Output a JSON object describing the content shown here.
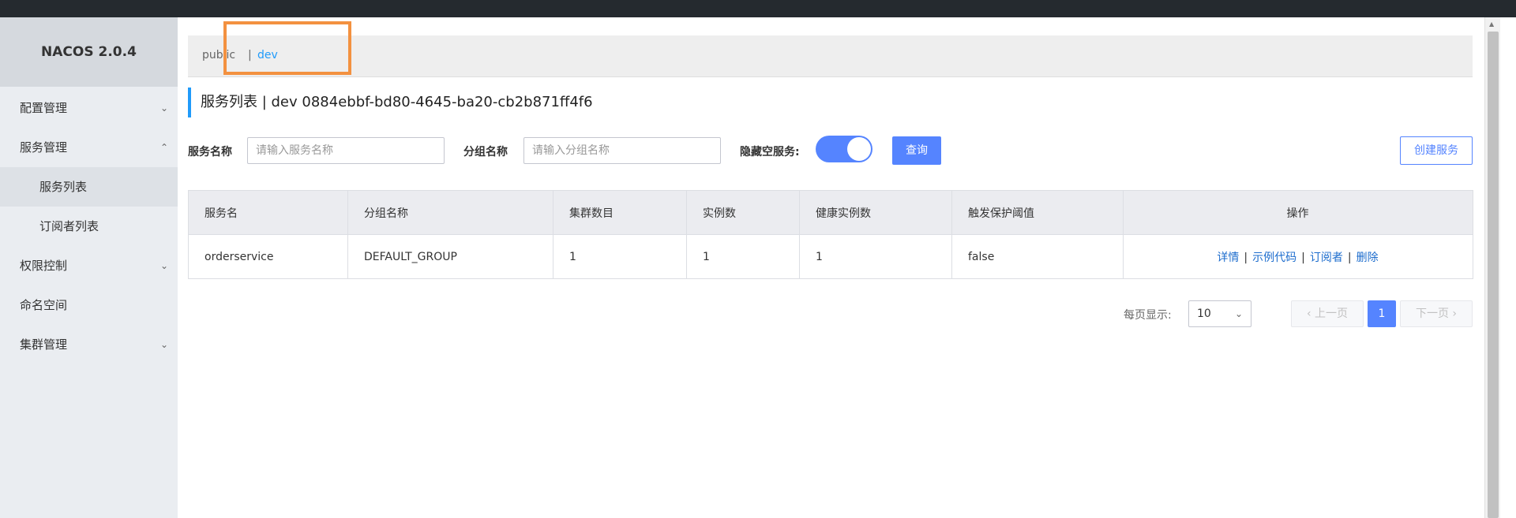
{
  "app": {
    "logo": "NACOS 2.0.4"
  },
  "sidebar": {
    "items": [
      {
        "label": "配置管理",
        "expanded": false
      },
      {
        "label": "服务管理",
        "expanded": true
      },
      {
        "label": "服务列表",
        "sub": true,
        "active": true
      },
      {
        "label": "订阅者列表",
        "sub": true
      },
      {
        "label": "权限控制",
        "expanded": false
      },
      {
        "label": "命名空间"
      },
      {
        "label": "集群管理",
        "expanded": false
      }
    ]
  },
  "namespaces": {
    "public": "public",
    "separator": "|",
    "dev": "dev"
  },
  "page": {
    "title": "服务列表  |  dev  0884ebbf-bd80-4645-ba20-cb2b871ff4f6"
  },
  "filters": {
    "service_name_label": "服务名称",
    "service_name_placeholder": "请输入服务名称",
    "group_name_label": "分组名称",
    "group_name_placeholder": "请输入分组名称",
    "hide_empty_label": "隐藏空服务:",
    "hide_empty_on": true,
    "query_button": "查询",
    "create_button": "创建服务"
  },
  "table": {
    "columns": [
      "服务名",
      "分组名称",
      "集群数目",
      "实例数",
      "健康实例数",
      "触发保护阈值",
      "操作"
    ],
    "rows": [
      {
        "name": "orderservice",
        "group": "DEFAULT_GROUP",
        "clusters": "1",
        "instances": "1",
        "healthy": "1",
        "threshold": "false",
        "ops": [
          "详情",
          "示例代码",
          "订阅者",
          "删除"
        ]
      }
    ],
    "op_separator": "|"
  },
  "pagination": {
    "page_size_label": "每页显示:",
    "page_size": "10",
    "prev": "上一页",
    "current": "1",
    "next": "下一页"
  },
  "colors": {
    "accent": "#5584ff",
    "link": "#1c6ccd",
    "highlight_box": "#f39140"
  }
}
